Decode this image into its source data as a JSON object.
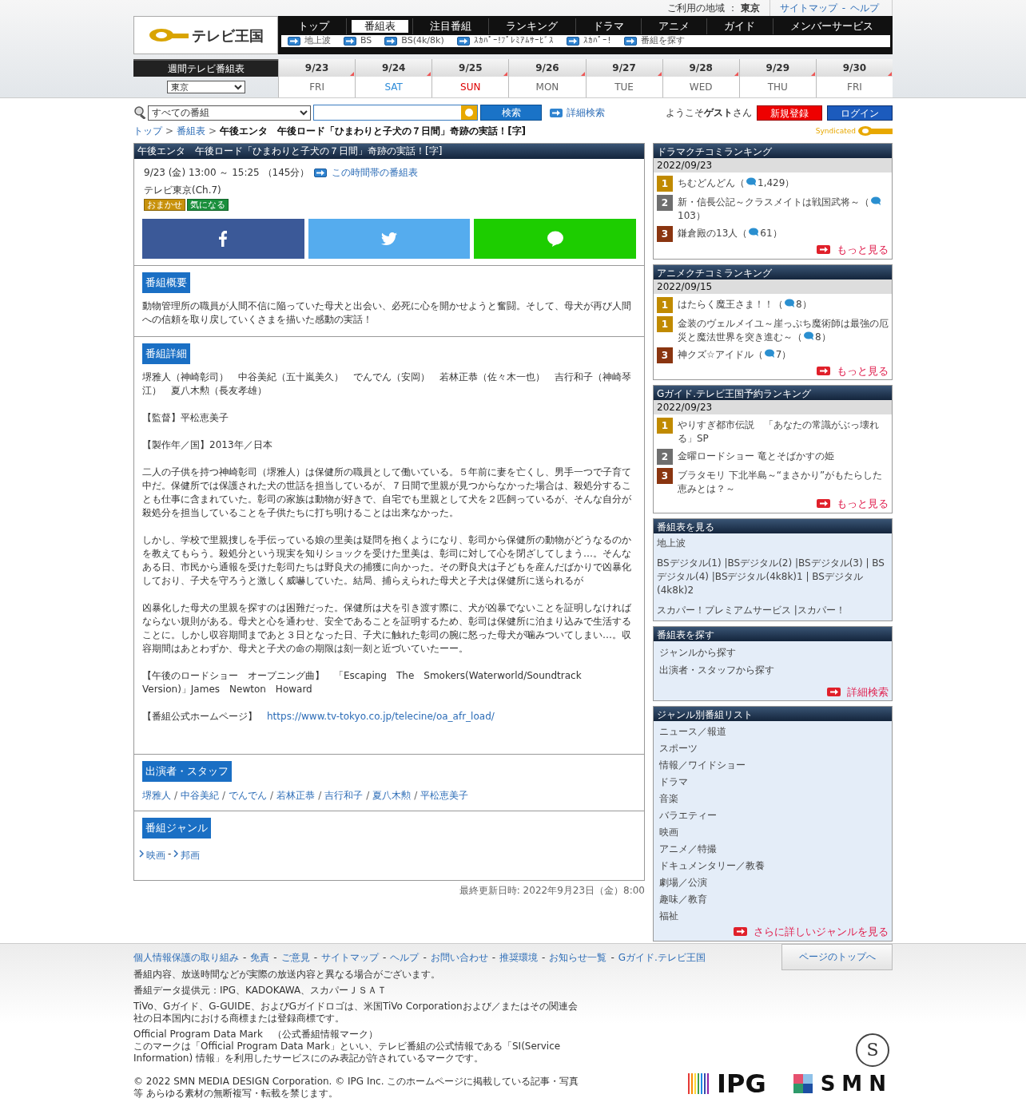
{
  "header": {
    "region_label": "ご利用の地域 ：",
    "region": "東京",
    "links": [
      "サイトマップ",
      "ヘルプ"
    ],
    "link_separator": "-",
    "logo": "テレビ王国"
  },
  "nav": {
    "tabs": [
      {
        "label": "トップ",
        "selected": false
      },
      {
        "label": "番組表",
        "selected": true
      },
      {
        "label": "注目番組",
        "selected": false
      },
      {
        "label": "ランキング",
        "selected": false
      },
      {
        "label": "ドラマ",
        "selected": false
      },
      {
        "label": "アニメ",
        "selected": false
      },
      {
        "label": "ガイド",
        "selected": false
      },
      {
        "label": "メンバーサービス",
        "selected": false
      }
    ],
    "subnav": [
      "地上波",
      "BS",
      "BS(4k/8k)",
      "ｽｶﾊﾟｰ!ﾌﾟﾚﾐｱﾑｻｰﾋﾞｽ",
      "ｽｶﾊﾟｰ!",
      "番組を探す"
    ]
  },
  "week": {
    "title": "週間テレビ番組表",
    "region_select": "東京",
    "days": [
      {
        "date": "9/23",
        "weekday": "FRI",
        "kind": "weekday"
      },
      {
        "date": "9/24",
        "weekday": "SAT",
        "kind": "saturday"
      },
      {
        "date": "9/25",
        "weekday": "SUN",
        "kind": "sunday"
      },
      {
        "date": "9/26",
        "weekday": "MON",
        "kind": "weekday"
      },
      {
        "date": "9/27",
        "weekday": "TUE",
        "kind": "weekday"
      },
      {
        "date": "9/28",
        "weekday": "WED",
        "kind": "weekday"
      },
      {
        "date": "9/29",
        "weekday": "THU",
        "kind": "weekday"
      },
      {
        "date": "9/30",
        "weekday": "FRI",
        "kind": "weekday"
      }
    ]
  },
  "search": {
    "select": "すべての番組",
    "button": "検索",
    "advanced": "詳細検索",
    "welcome": "ようこそ**ゲスト**さん",
    "register": "新規登録",
    "login": "ログイン"
  },
  "breadcrumb": {
    "links": [
      "トップ",
      "番組表"
    ],
    "separator": ">",
    "current": "午後エンタ　午後ロード「ひまわりと子犬の７日間」奇跡の実話！[字]"
  },
  "syndicated": "Syndicated",
  "program": {
    "title": "午後エンタ　午後ロード「ひまわりと子犬の７日間」奇跡の実話！[字]",
    "time": "9/23 (金) 13:00 ～ 15:25 （145分）",
    "timetable_link": "この時間帯の番組表",
    "channel": "テレビ東京(Ch.7)",
    "tags": [
      {
        "label": "おまかせ",
        "color": "#c8920c"
      },
      {
        "label": "気になる",
        "color": "#1a8f3c"
      }
    ],
    "sections": [
      {
        "kind": "text",
        "heading": "番組概要",
        "paragraphs": [
          {
            "text": "動物管理所の職員が人間不信に陥っていた母犬と出会い、必死に心を開かせようと奮闘。そして、母犬が再び人間への信頼を取り戻していくさまを描いた感動の実話！"
          }
        ]
      },
      {
        "kind": "text",
        "heading": "番組詳細",
        "paragraphs": [
          {
            "text": "堺雅人（神崎彰司）　中谷美紀（五十嵐美久）　でんでん（安岡）　若林正恭（佐々木一也）　吉行和子（神崎琴江）　夏八木勲（長友孝雄）"
          },
          {
            "text": "【監督】平松恵美子"
          },
          {
            "text": "【製作年／国】2013年／日本"
          },
          {
            "text": "二人の子供を持つ神崎彰司（堺雅人）は保健所の職員として働いている。５年前に妻を亡くし、男手一つで子育て中だ。保健所では保護された犬の世話を担当しているが、７日間で里親が見つからなかった場合は、殺処分することも仕事に含まれていた。彰司の家族は動物が好きで、自宅でも里親として犬を２匹飼っているが、そんな自分が殺処分を担当していることを子供たちに打ち明けることは出来なかった。"
          },
          {
            "text": "しかし、学校で里親捜しを手伝っている娘の里美は疑問を抱くようになり、彰司から保健所の動物がどうなるのかを教えてもらう。殺処分という現実を知りショックを受けた里美は、彰司に対して心を閉ざしてしまう…。そんなある日、市民から通報を受けた彰司たちは野良犬の捕獲に向かった。その野良犬は子どもを産んだばかりで凶暴化しており、子犬を守ろうと激しく威嚇していた。結局、捕らえられた母犬と子犬は保健所に送られるが"
          },
          {
            "text": "凶暴化した母犬の里親を探すのは困難だった。保健所は犬を引き渡す際に、犬が凶暴でないことを証明しなければならない規則がある。母犬と心を通わせ、安全であることを証明するため、彰司は保健所に泊まり込みで生活することに。しかし収容期間まであと３日となった日、子犬に触れた彰司の腕に怒った母犬が噛みついてしまい…。収容期間はあとわずか、母犬と子犬の命の期限は刻一刻と近づいていたーー。"
          },
          {
            "text": "【午後のロードショー　オープニング曲】　「Escaping　The　Smokers(Waterworld/Soundtrack　Version)」James　Newton　Howard"
          },
          {
            "text": "【番組公式ホームページ】　",
            "link": "https://www.tv-tokyo.co.jp/telecine/oa_afr_load/"
          }
        ]
      },
      {
        "kind": "cast",
        "heading": "出演者・スタッフ",
        "links": [
          "堺雅人",
          "中谷美紀",
          "でんでん",
          "若林正恭",
          "吉行和子",
          "夏八木勲",
          "平松恵美子"
        ],
        "separator": "/"
      },
      {
        "kind": "genre",
        "heading": "番組ジャンル",
        "links": [
          "映画",
          "邦画"
        ],
        "separator": "-"
      }
    ]
  },
  "updated": "最終更新日時: 2022年9月23日（金）8:00",
  "sidebar": {
    "rankings": [
      {
        "title": "ドラマクチコミランキング",
        "date": "2022/09/23",
        "more": "もっと見る",
        "items": [
          {
            "rank": "1",
            "color": "#c08a00",
            "title": "ちむどんどん（",
            "count": "1,429）"
          },
          {
            "rank": "2",
            "color": "#6e6e6e",
            "title": "新・信長公記～クラスメイトは戦国武将～（",
            "count": "103）"
          },
          {
            "rank": "3",
            "color": "#8a3510",
            "title": "鎌倉殿の13人（",
            "count": "61）"
          }
        ]
      },
      {
        "title": "アニメクチコミランキング",
        "date": "2022/09/15",
        "more": "もっと見る",
        "items": [
          {
            "rank": "1",
            "color": "#c08a00",
            "title": "はたらく魔王さま！！（",
            "count": "8）"
          },
          {
            "rank": "1",
            "color": "#c08a00",
            "title": "金装のヴェルメイユ～崖っぷち魔術師は最強の厄災と魔法世界を突き進む～（",
            "count": "8）"
          },
          {
            "rank": "3",
            "color": "#8a3510",
            "title": "神クズ☆アイドル（",
            "count": "7）"
          }
        ]
      },
      {
        "title": "Gガイド.テレビ王国予約ランキング",
        "date": "2022/09/23",
        "more": "もっと見る",
        "items": [
          {
            "rank": "1",
            "color": "#c08a00",
            "title": "やりすぎ都市伝説　「あなたの常識がぶっ壊れる」SP"
          },
          {
            "rank": "2",
            "color": "#6e6e6e",
            "title": "金曜ロードショー 竜とそばかすの姫"
          },
          {
            "rank": "3",
            "color": "#8a3510",
            "title": "ブラタモリ 下北半島～“まさかり”がもたらした恵みとは？～"
          }
        ]
      }
    ],
    "channels": {
      "title": "番組表を見る",
      "groups": [
        "地上波",
        "BSデジタル(1) |BSデジタル(2) |BSデジタル(3) | BSデジタル(4) |BSデジタル(4k8k)1 | BSデジタル(4k8k)2",
        "スカパー！プレミアムサービス |スカパー！"
      ]
    },
    "find": {
      "title": "番組表を探す",
      "links": [
        "ジャンルから探す",
        "出演者・スタッフから探す"
      ],
      "more": "詳細検索"
    },
    "genres": {
      "title": "ジャンル別番組リスト",
      "items": [
        "ニュース／報道",
        "スポーツ",
        "情報／ワイドショー",
        "ドラマ",
        "音楽",
        "バラエティー",
        "映画",
        "アニメ／特撮",
        "ドキュメンタリー／教養",
        "劇場／公演",
        "趣味／教育",
        "福祉"
      ],
      "more": "さらに詳しいジャンルを見る"
    }
  },
  "footer": {
    "links": [
      "個人情報保護の取り組み",
      "免責",
      "ご意見",
      "サイトマップ",
      "ヘルプ",
      "お問い合わせ",
      "推奨環境",
      "お知らせ一覧",
      "Gガイド.テレビ王国"
    ],
    "separator": "-",
    "top_button": "ページのトップへ",
    "notes": [
      [
        "番組内容、放送時間などが実際の放送内容と異なる場合がございます。"
      ],
      [
        "番組データ提供元：IPG、KADOKAWA、スカパーＪＳＡＴ"
      ],
      [
        "TiVo、Gガイド、G-GUIDE、およびGガイドロゴは、米国TiVo Corporationおよび／またはその関連会社の日本国内における商標または登録商標です。"
      ],
      [
        "Official Program Data Mark　（公式番組情報マーク）",
        "このマークは「Official Program Data Mark」といい、テレビ番組の公式情報である「SI(Service Information) 情報」を利用したサービスにのみ表記が許されているマークです。"
      ]
    ],
    "copyright": "© 2022 SMN MEDIA DESIGN Corporation. © IPG Inc. このホームページに掲載している記事・写真等 あらゆる素材の無断複写・転載を禁じます。",
    "mark": "S",
    "logos": [
      "IPG",
      "SMN"
    ]
  }
}
